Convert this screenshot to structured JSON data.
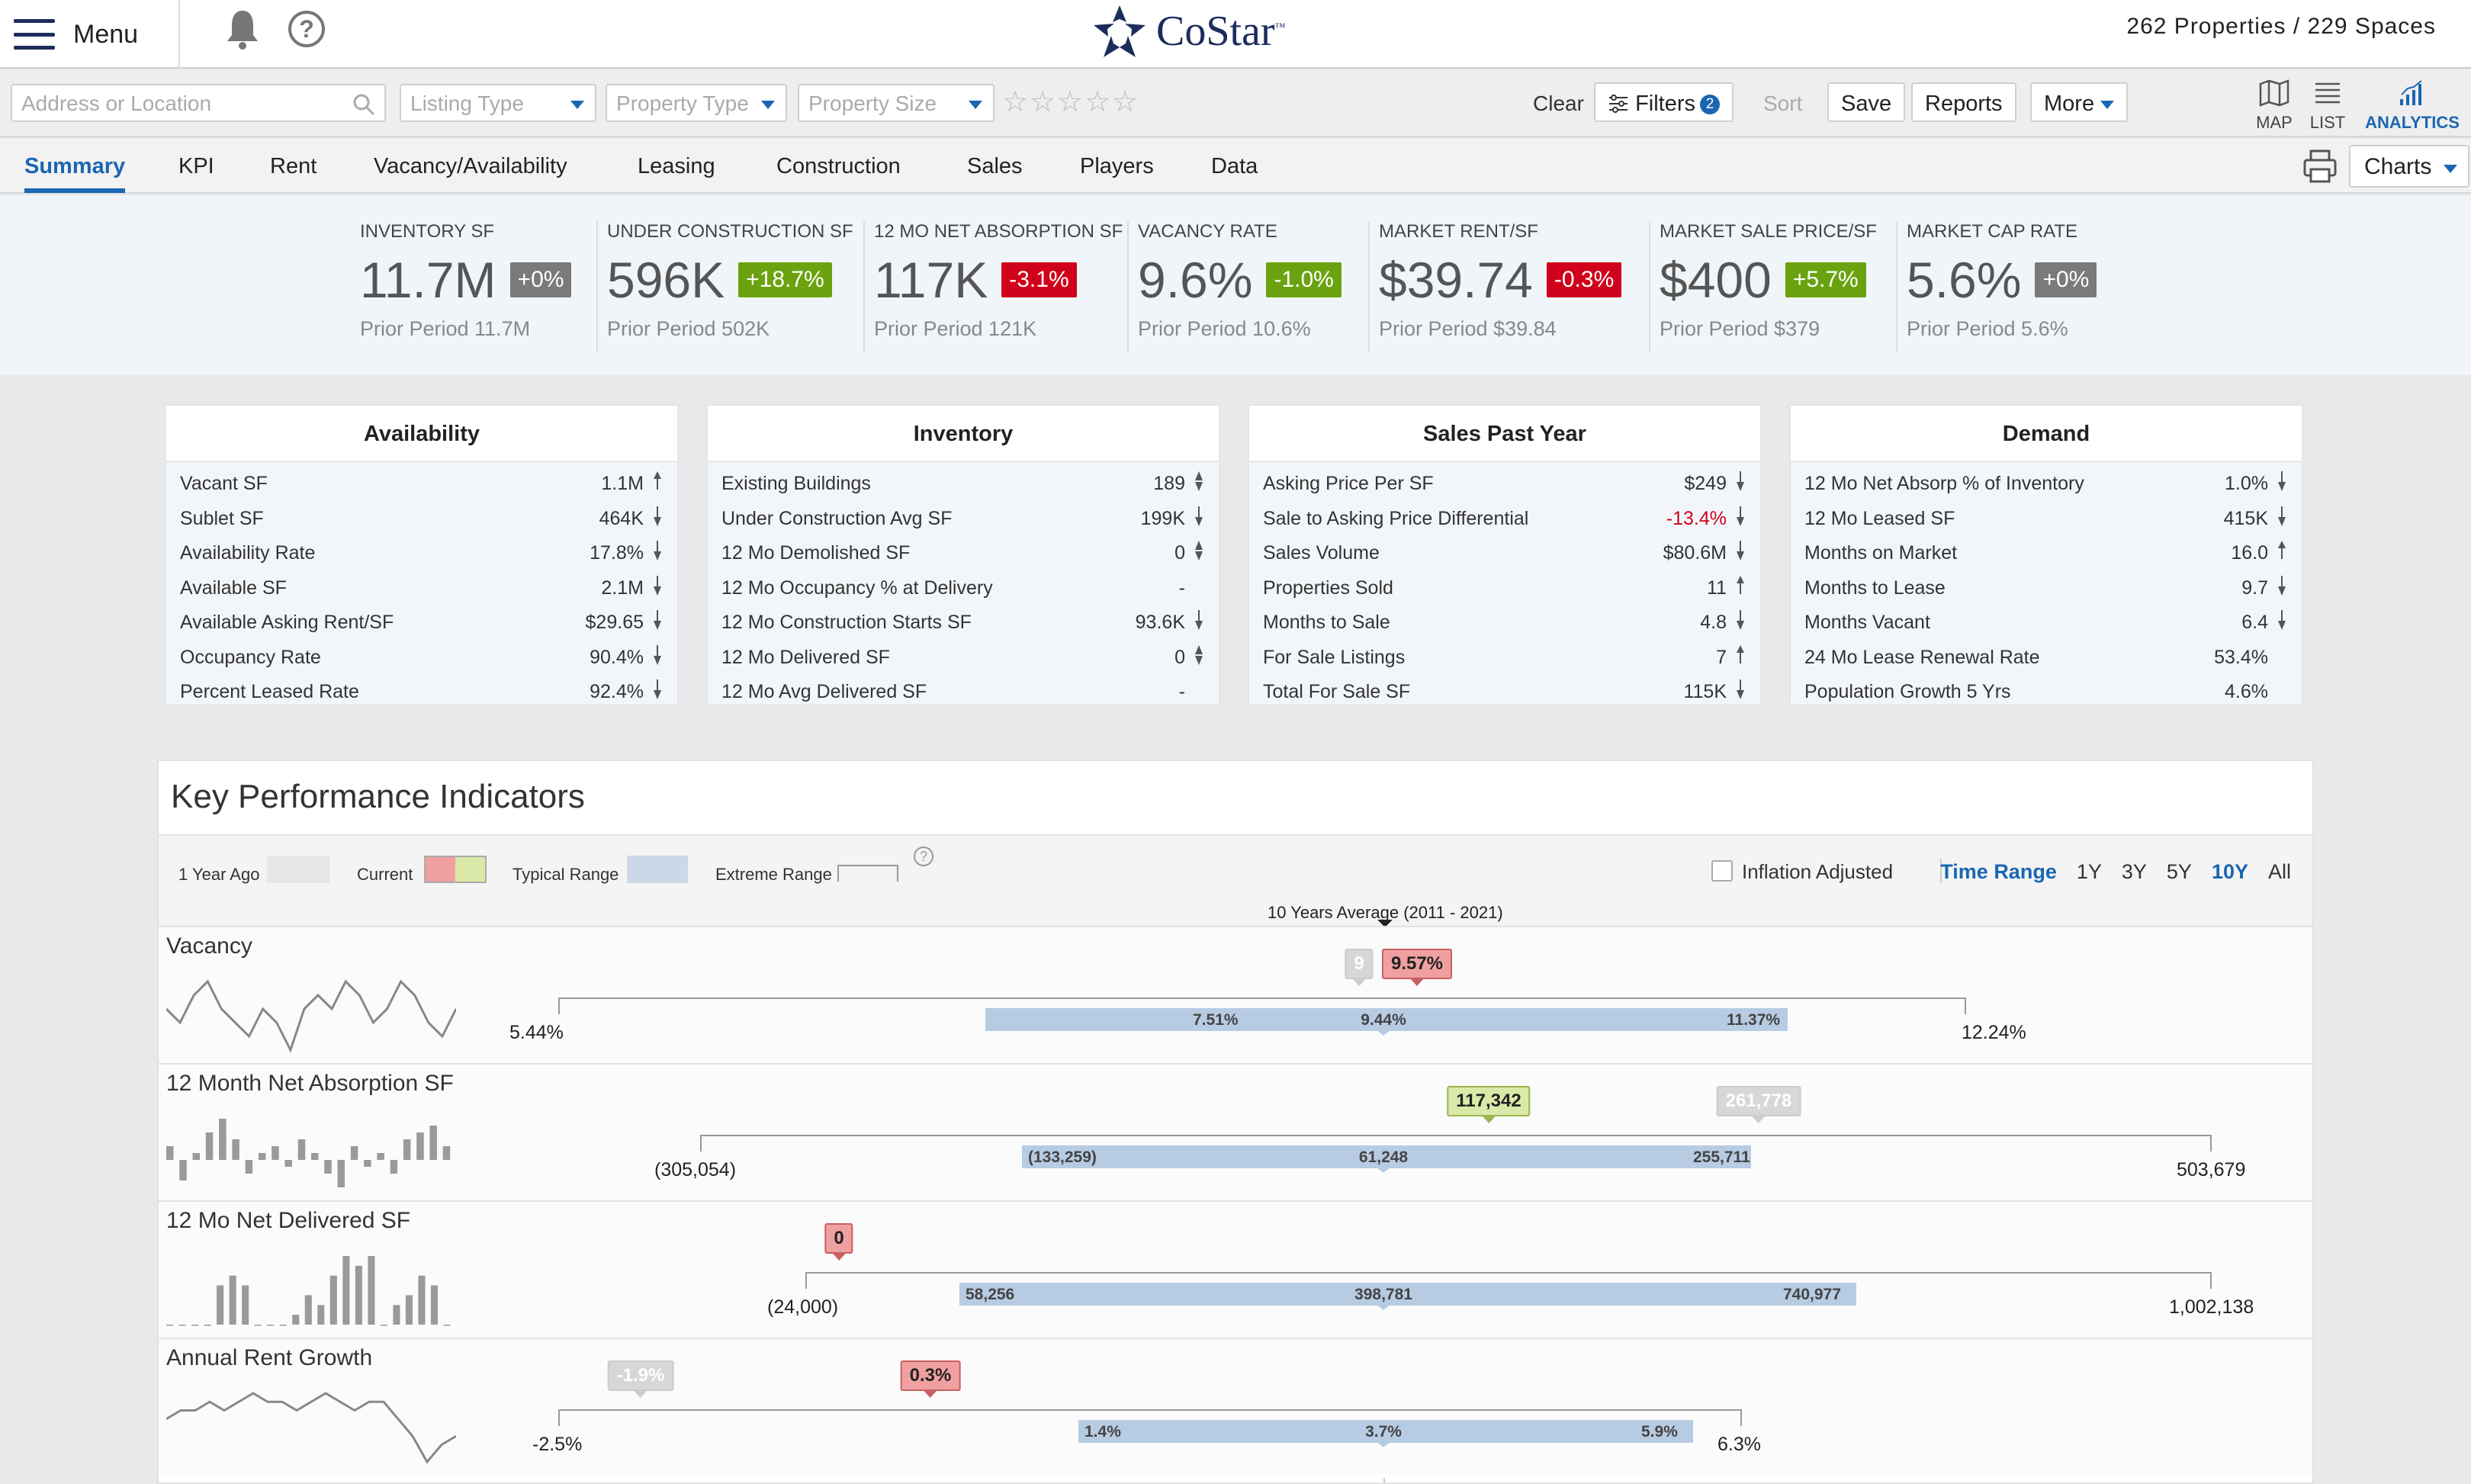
{
  "topbar": {
    "menu_label": "Menu",
    "logo_text": "CoStar",
    "logo_tm": "™",
    "counts": "262 Properties / 229 Spaces"
  },
  "filters": {
    "address_placeholder": "Address or Location",
    "listing_type": "Listing Type",
    "property_type": "Property Type",
    "property_size": "Property Size",
    "star_rating": 0,
    "clear": "Clear",
    "filters": "Filters",
    "filters_count": "2",
    "sort": "Sort",
    "save": "Save",
    "reports": "Reports",
    "more": "More",
    "views": [
      {
        "label": "MAP",
        "icon": "map-icon"
      },
      {
        "label": "LIST",
        "icon": "list-icon"
      },
      {
        "label": "ANALYTICS",
        "icon": "analytics-icon",
        "active": true
      }
    ]
  },
  "tabs": [
    {
      "label": "Summary",
      "active": true
    },
    {
      "label": "KPI"
    },
    {
      "label": "Rent"
    },
    {
      "label": "Vacancy/Availability"
    },
    {
      "label": "Leasing"
    },
    {
      "label": "Construction"
    },
    {
      "label": "Sales"
    },
    {
      "label": "Players"
    },
    {
      "label": "Data"
    }
  ],
  "charts_button": "Charts",
  "colors": {
    "up": "#6aa30f",
    "down": "#d0021b",
    "neutral": "#7a7a7a",
    "accent": "#1a66b3",
    "band": "#b7cbe3"
  },
  "summary": [
    {
      "title": "INVENTORY SF",
      "value": "11.7M",
      "change": "+0%",
      "tone": "neutral",
      "prior": "Prior Period 11.7M"
    },
    {
      "title": "UNDER CONSTRUCTION SF",
      "value": "596K",
      "change": "+18.7%",
      "tone": "up",
      "prior": "Prior Period 502K"
    },
    {
      "title": "12 MO NET ABSORPTION SF",
      "value": "117K",
      "change": "-3.1%",
      "tone": "down",
      "prior": "Prior Period 121K"
    },
    {
      "title": "VACANCY RATE",
      "value": "9.6%",
      "change": "-1.0%",
      "tone": "up",
      "prior": "Prior Period 10.6%"
    },
    {
      "title": "MARKET RENT/SF",
      "value": "$39.74",
      "change": "-0.3%",
      "tone": "down",
      "prior": "Prior Period $39.84"
    },
    {
      "title": "MARKET SALE PRICE/SF",
      "value": "$400",
      "change": "+5.7%",
      "tone": "up",
      "prior": "Prior Period $379"
    },
    {
      "title": "MARKET CAP RATE",
      "value": "5.6%",
      "change": "+0%",
      "tone": "neutral",
      "prior": "Prior Period 5.6%"
    }
  ],
  "cards": [
    {
      "title": "Availability",
      "rows": [
        {
          "label": "Vacant SF",
          "value": "1.1M",
          "trend": "up"
        },
        {
          "label": "Sublet SF",
          "value": "464K",
          "trend": "down"
        },
        {
          "label": "Availability Rate",
          "value": "17.8%",
          "trend": "down"
        },
        {
          "label": "Available SF",
          "value": "2.1M",
          "trend": "down"
        },
        {
          "label": "Available Asking Rent/SF",
          "value": "$29.65",
          "trend": "down"
        },
        {
          "label": "Occupancy Rate",
          "value": "90.4%",
          "trend": "down"
        },
        {
          "label": "Percent Leased Rate",
          "value": "92.4%",
          "trend": "down"
        }
      ]
    },
    {
      "title": "Inventory",
      "rows": [
        {
          "label": "Existing Buildings",
          "value": "189",
          "trend": "flat"
        },
        {
          "label": "Under Construction Avg SF",
          "value": "199K",
          "trend": "down"
        },
        {
          "label": "12 Mo Demolished SF",
          "value": "0",
          "trend": "flat"
        },
        {
          "label": "12 Mo Occupancy % at Delivery",
          "value": "-",
          "trend": "none"
        },
        {
          "label": "12 Mo Construction Starts SF",
          "value": "93.6K",
          "trend": "down"
        },
        {
          "label": "12 Mo Delivered SF",
          "value": "0",
          "trend": "flat"
        },
        {
          "label": "12 Mo Avg Delivered SF",
          "value": "-",
          "trend": "none"
        }
      ]
    },
    {
      "title": "Sales Past Year",
      "rows": [
        {
          "label": "Asking Price Per SF",
          "value": "$249",
          "trend": "down"
        },
        {
          "label": "Sale to Asking Price Differential",
          "value": "-13.4%",
          "trend": "down",
          "neg": true
        },
        {
          "label": "Sales Volume",
          "value": "$80.6M",
          "trend": "down"
        },
        {
          "label": "Properties Sold",
          "value": "11",
          "trend": "up"
        },
        {
          "label": "Months to Sale",
          "value": "4.8",
          "trend": "down"
        },
        {
          "label": "For Sale Listings",
          "value": "7",
          "trend": "up"
        },
        {
          "label": "Total For Sale SF",
          "value": "115K",
          "trend": "down"
        }
      ]
    },
    {
      "title": "Demand",
      "rows": [
        {
          "label": "12 Mo Net Absorp % of Inventory",
          "value": "1.0%",
          "trend": "down"
        },
        {
          "label": "12 Mo Leased SF",
          "value": "415K",
          "trend": "down"
        },
        {
          "label": "Months on Market",
          "value": "16.0",
          "trend": "up"
        },
        {
          "label": "Months to Lease",
          "value": "9.7",
          "trend": "down"
        },
        {
          "label": "Months Vacant",
          "value": "6.4",
          "trend": "down"
        },
        {
          "label": "24 Mo Lease Renewal Rate",
          "value": "53.4%",
          "trend": "none"
        },
        {
          "label": "Population Growth 5 Yrs",
          "value": "4.6%",
          "trend": "none"
        }
      ]
    }
  ],
  "kpi": {
    "title": "Key Performance Indicators",
    "legend": {
      "year_ago": "1 Year Ago",
      "current": "Current",
      "typical": "Typical Range",
      "extreme": "Extreme Range"
    },
    "inflation_label": "Inflation Adjusted",
    "time_range_label": "Time Range",
    "time_options": [
      "1Y",
      "3Y",
      "5Y",
      "10Y",
      "All"
    ],
    "time_selected": "10Y",
    "average_label": "10 Years Average (2011 - 2021)"
  },
  "chart_data": {
    "type": "range",
    "rows": [
      {
        "name": "Vacancy",
        "extreme_min": "5.44%",
        "typical_low": "7.51%",
        "average": "9.44%",
        "typical_high": "11.37%",
        "extreme_max": "12.24%",
        "current": "9.57%",
        "year_ago": "9",
        "spark": [
          6,
          5,
          7,
          8,
          6,
          5,
          4,
          6,
          5,
          3,
          6,
          7,
          6,
          8,
          7,
          5,
          6,
          8,
          7,
          5,
          4,
          6
        ]
      },
      {
        "name": "12 Month Net Absorption SF",
        "extreme_min": "(305,054)",
        "typical_low": "(133,259)",
        "average": "61,248",
        "typical_high": "255,711",
        "extreme_max": "503,679",
        "current": "117,342",
        "year_ago": "261,778",
        "spark": [
          2,
          -3,
          1,
          4,
          6,
          3,
          -2,
          1,
          2,
          -1,
          3,
          1,
          -2,
          -4,
          2,
          -1,
          1,
          -2,
          3,
          4,
          5,
          2
        ]
      },
      {
        "name": "12 Mo Net Delivered SF",
        "extreme_min": "(24,000)",
        "typical_low": "58,256",
        "average": "398,781",
        "typical_high": "740,977",
        "extreme_max": "1,002,138",
        "current": "0",
        "spark": [
          0,
          0,
          0,
          0,
          4,
          5,
          4,
          0,
          0,
          0,
          1,
          3,
          2,
          5,
          7,
          6,
          7,
          0,
          2,
          3,
          5,
          4,
          0
        ]
      },
      {
        "name": "Annual Rent Growth",
        "extreme_min": "-2.5%",
        "typical_low": "1.4%",
        "average": "3.7%",
        "typical_high": "5.9%",
        "extreme_max": "6.3%",
        "current": "0.3%",
        "year_ago": "-1.9%",
        "spark": [
          3,
          4,
          4,
          5,
          4,
          5,
          6,
          5,
          5,
          4,
          5,
          6,
          5,
          4,
          5,
          5,
          3,
          1,
          -2,
          0,
          1
        ]
      }
    ]
  }
}
